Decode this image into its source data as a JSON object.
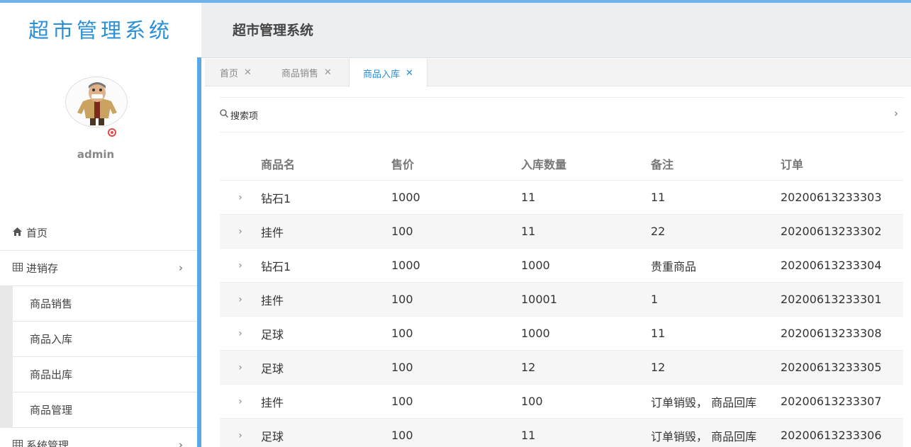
{
  "app": {
    "brand": "超市管理系统",
    "header_title": "超市管理系统"
  },
  "user": {
    "name": "admin",
    "status_color": "#e54848"
  },
  "sidebar": {
    "items": [
      {
        "label": "首页",
        "icon": "home-icon"
      },
      {
        "label": "进销存",
        "icon": "table-icon"
      },
      {
        "label": "系统管理",
        "icon": "table-icon"
      }
    ],
    "submenu": [
      {
        "label": "商品销售"
      },
      {
        "label": "商品入库"
      },
      {
        "label": "商品出库"
      },
      {
        "label": "商品管理"
      }
    ]
  },
  "tabs": [
    {
      "label": "首页"
    },
    {
      "label": "商品销售"
    },
    {
      "label": "商品入库",
      "active": true
    }
  ],
  "search": {
    "label": "搜索项"
  },
  "table": {
    "headers": [
      "商品名",
      "售价",
      "入库数量",
      "备注",
      "订单"
    ],
    "rows": [
      [
        "钻石1",
        "1000",
        "11",
        "11",
        "20200613233303"
      ],
      [
        "挂件",
        "100",
        "11",
        "22",
        "20200613233302"
      ],
      [
        "钻石1",
        "1000",
        "1000",
        "贵重商品",
        "20200613233304"
      ],
      [
        "挂件",
        "100",
        "10001",
        "1",
        "20200613233301"
      ],
      [
        "足球",
        "100",
        "1000",
        "11",
        "20200613233308"
      ],
      [
        "足球",
        "100",
        "12",
        "12",
        "20200613233305"
      ],
      [
        "挂件",
        "100",
        "100",
        "订单销毁， 商品回库",
        "20200613233307"
      ],
      [
        "足球",
        "100",
        "11",
        "订单销毁， 商品回库",
        "20200613233306"
      ]
    ]
  },
  "colors": {
    "accent": "#2d8cd0",
    "brand": "#2b8fd6",
    "sidebar_accent": "#5aa7e6"
  }
}
